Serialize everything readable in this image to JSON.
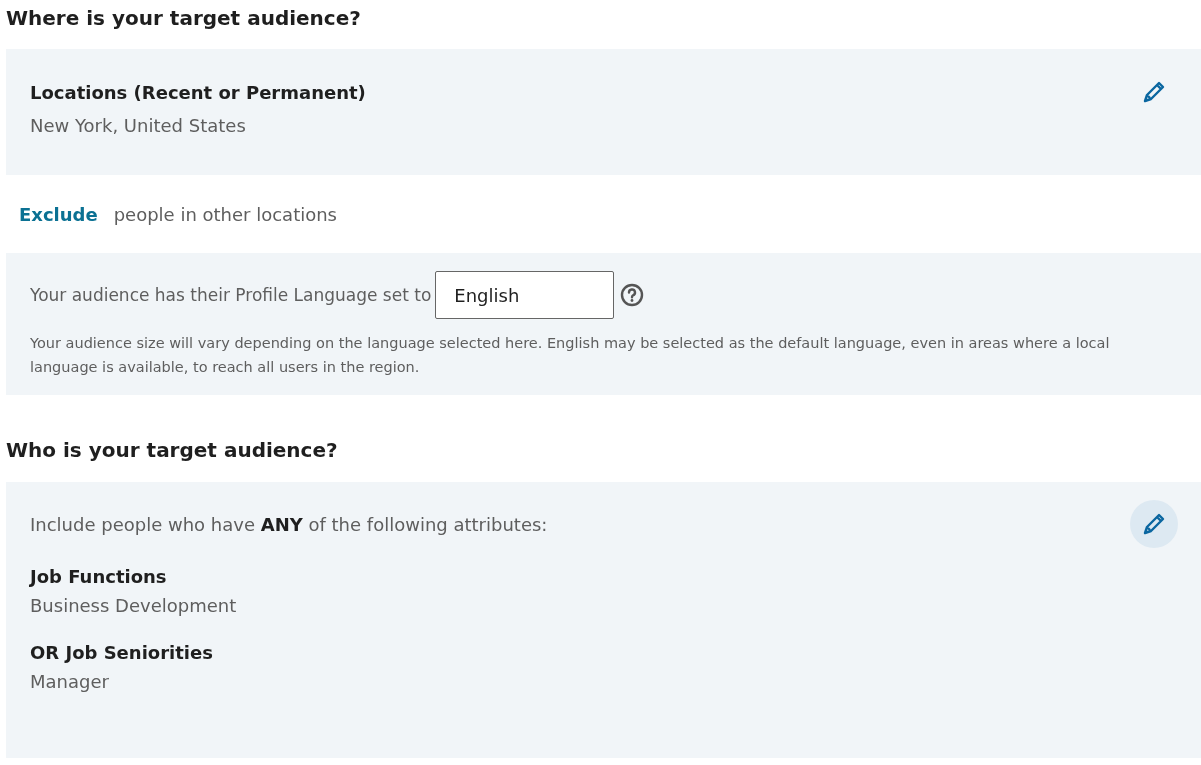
{
  "where_section": {
    "heading": "Where is your target audience?",
    "locations_card": {
      "label": "Locations (Recent or Permanent)",
      "value": "New York, United States",
      "edit_button": {
        "highlighted": false
      }
    },
    "exclude_row": {
      "link": "Exclude",
      "text": "people in other locations"
    },
    "language_card": {
      "prefix": "Your audience has their Profile Language set to",
      "language_field": {
        "value": "English"
      },
      "note": "Your audience size will vary depending on the language selected here. English may be selected as the default language, even in areas where a local language is available, to reach all users in the region."
    }
  },
  "who_section": {
    "heading": "Who is your target audience?",
    "attributes_card": {
      "intro": "Include people who have **ANY** of the following attributes:",
      "edit_button": {
        "highlighted": true
      },
      "groups": [
        {
          "label": "Job Functions",
          "value": "Business Development"
        },
        {
          "label": "OR Job Seniorities",
          "value": "Manager"
        }
      ]
    }
  }
}
